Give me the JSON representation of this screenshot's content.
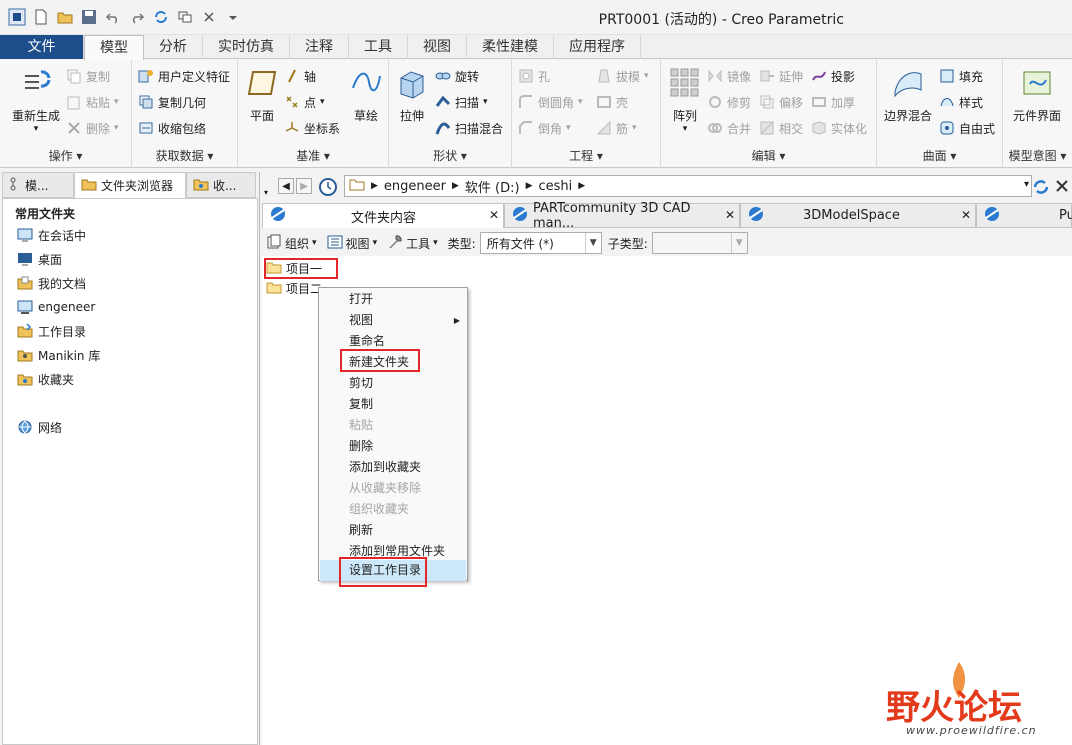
{
  "window": {
    "title": "PRT0001 (活动的) - Creo Parametric"
  },
  "ribbon_tabs": [
    "文件",
    "模型",
    "分析",
    "实时仿真",
    "注释",
    "工具",
    "视图",
    "柔性建模",
    "应用程序"
  ],
  "ribbon": {
    "ops": {
      "label": "操作",
      "regen": "重新生成",
      "copy": "复制",
      "paste": "粘贴",
      "delete": "删除"
    },
    "getdata": {
      "label": "获取数据",
      "udf": "用户定义特征",
      "copygeom": "复制几何",
      "shrinkwrap": "收缩包络"
    },
    "datum": {
      "label": "基准",
      "plane": "平面",
      "axis": "轴",
      "point": "点",
      "csys": "坐标系",
      "sketch": "草绘"
    },
    "shapes": {
      "label": "形状",
      "extrude": "拉伸",
      "revolve": "旋转",
      "sweep": "扫描",
      "sweptblend": "扫描混合"
    },
    "eng": {
      "label": "工程",
      "hole": "孔",
      "round": "倒圆角",
      "chamfer": "倒角",
      "draft": "拔模",
      "shell": "壳",
      "rib": "筋"
    },
    "edit": {
      "label": "编辑",
      "pattern": "阵列",
      "mirror": "镜像",
      "trim": "修剪",
      "merge": "合并",
      "extend": "延伸",
      "offset": "偏移",
      "intersect": "相交",
      "project": "投影",
      "thicken": "加厚",
      "solidify": "实体化"
    },
    "surf": {
      "label": "曲面",
      "boundary": "边界混合",
      "fill": "填充",
      "style": "样式",
      "freestyle": "自由式"
    },
    "intent": {
      "label": "模型意图",
      "component": "元件界面"
    }
  },
  "left_panel": {
    "tabs": [
      "模...",
      "文件夹浏览器",
      "收..."
    ],
    "heading": "常用文件夹",
    "items": [
      "在会话中",
      "桌面",
      "我的文档",
      "engeneer",
      "工作目录",
      "Manikin 库",
      "收藏夹",
      "网络"
    ]
  },
  "address": {
    "segments": [
      "engeneer",
      "软件 (D:)",
      "ceshi"
    ]
  },
  "browser_tabs": [
    "文件夹内容",
    "PARTcommunity 3D CAD man...",
    "3DModelSpace",
    "Pu"
  ],
  "toolbar": {
    "organize": "组织",
    "view": "视图",
    "tools": "工具",
    "type_label": "类型:",
    "type_value": "所有文件 (*)",
    "subtype_label": "子类型:",
    "subtype_value": ""
  },
  "files": [
    "项目一",
    "项目二"
  ],
  "context_menu": {
    "items": [
      {
        "label": "打开",
        "enabled": true
      },
      {
        "label": "视图",
        "enabled": true,
        "submenu": true
      },
      {
        "label": "重命名",
        "enabled": true
      },
      {
        "label": "新建文件夹",
        "enabled": true,
        "highlight": true
      },
      {
        "label": "剪切",
        "enabled": true
      },
      {
        "label": "复制",
        "enabled": true
      },
      {
        "label": "粘贴",
        "enabled": false
      },
      {
        "label": "删除",
        "enabled": true
      },
      {
        "label": "添加到收藏夹",
        "enabled": true
      },
      {
        "label": "从收藏夹移除",
        "enabled": false
      },
      {
        "label": "组织收藏夹",
        "enabled": false
      },
      {
        "label": "刷新",
        "enabled": true
      },
      {
        "label": "添加到常用文件夹",
        "enabled": true
      },
      {
        "label": "设置工作目录",
        "enabled": true,
        "hovered": true,
        "highlight": true
      }
    ]
  },
  "watermark": {
    "text": "野火论坛",
    "url": "www.proewildfire.cn"
  },
  "colors": {
    "file_tab": "#1d4e8b",
    "highlight_box": "#e2262a",
    "menu_hover": "#cde8fb",
    "watermark": "#e23a1a"
  }
}
